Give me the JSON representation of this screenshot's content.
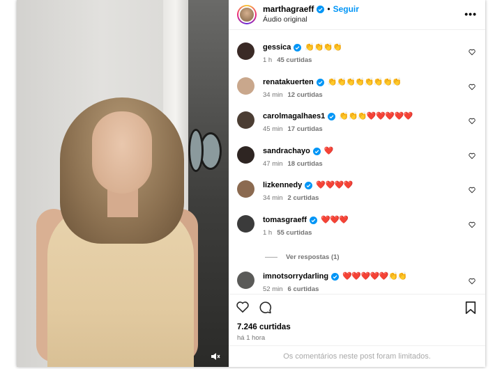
{
  "header": {
    "username": "marthagraeff",
    "separator": "•",
    "follow_label": "Seguir",
    "audio_label": "Áudio original",
    "more_label": "•••"
  },
  "comments": [
    {
      "user": "gessica",
      "verified": true,
      "text": "👏👏👏👏",
      "time": "1 h",
      "likes": "45 curtidas",
      "avatar_color": "#3a2a26"
    },
    {
      "user": "renatakuerten",
      "verified": true,
      "text": "👏👏👏👏👏👏👏👏",
      "time": "34 min",
      "likes": "12 curtidas",
      "avatar_color": "#c9a78c"
    },
    {
      "user": "carolmagalhaes1",
      "verified": true,
      "text": "👏👏👏❤️❤️❤️❤️❤️",
      "time": "45 min",
      "likes": "17 curtidas",
      "avatar_color": "#4b3d33"
    },
    {
      "user": "sandrachayo",
      "verified": true,
      "text": "❤️",
      "time": "47 min",
      "likes": "18 curtidas",
      "avatar_color": "#2e2522"
    },
    {
      "user": "lizkennedy",
      "verified": true,
      "text": "❤️❤️❤️❤️",
      "time": "34 min",
      "likes": "2 curtidas",
      "avatar_color": "#8b6a50"
    },
    {
      "user": "tomasgraeff",
      "verified": true,
      "text": "❤️❤️❤️",
      "time": "1 h",
      "likes": "55 curtidas",
      "avatar_color": "#3b3b3b"
    },
    {
      "user": "imnotsorrydarling",
      "verified": true,
      "text": "❤️❤️❤️❤️❤️👏👏",
      "time": "52 min",
      "likes": "6 curtidas",
      "avatar_color": "#5a5a58"
    }
  ],
  "view_replies_label": "Ver respostas (1)",
  "likes_total": "7.246 curtidas",
  "post_time": "há 1 hora",
  "limited_notice": "Os comentários neste post foram limitados.",
  "colors": {
    "accent": "#0095f6",
    "verified": "#0095f6",
    "muted": "#737373"
  }
}
